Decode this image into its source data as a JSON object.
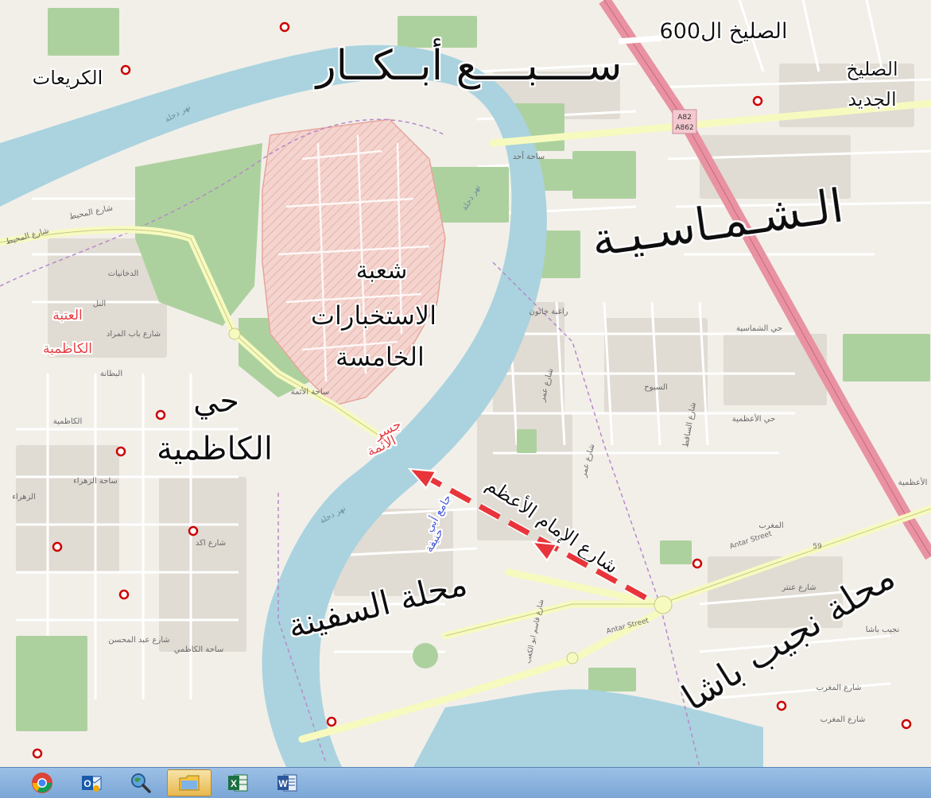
{
  "map": {
    "labels": {
      "sulaikh600": "الصليخ ال600",
      "sabaa_abkar": "ســــبــــع أبــكــار",
      "sulaikh_jadid_1": "الصليخ",
      "sulaikh_jadid_2": "الجديد",
      "kuraiat": "الكريعات",
      "shamasiya": "الـشـمـاسـيـة",
      "shuaba_1": "شعبة",
      "shuaba_2": "الاستخبارات",
      "shuaba_3": "الخامسة",
      "ataba_1": "العتبة",
      "ataba_2": "الكاظمية",
      "hay_1": "حي",
      "hay_2": "الكاظمية",
      "jisr_1": "جسر",
      "jisr_2": "الأئمة",
      "jami_1": "جامع أبي",
      "jami_2": "حنيفة",
      "imam_street": "شارع الإمام الأعظم",
      "safina": "محلة السفينة",
      "najib": "محلة نجيب باشا"
    },
    "small_labels": {
      "a82": "A82",
      "a862": "A862",
      "sahat_ahad": "ساحة أحد",
      "nahr_dijla": "نهر دجلة",
      "raghiba": "راغبة خاتون",
      "hay_shamasiya": "حي الشماسية",
      "suwaij": "السبوح",
      "hay_adhamiya": "حي الأعظمية",
      "adhamiya": "الأعظمية",
      "maghrib": "المغرب",
      "antar1": "Antar Street",
      "antar2": "Antar Street",
      "najib_small": "نجيب باشا",
      "sh_maghrib1": "شارع المغرب",
      "sh_maghrib2": "شارع المغرب",
      "sh_muhit": "شارع المحيط",
      "sh_muhit2": "شارع المحيط",
      "dakhaniyat": "الدخانيات",
      "bab_murad": "شارع باب المراد",
      "tall": "التل",
      "battana": "البطانة",
      "kadhimiya": "الكاظمية",
      "sahat_aimma": "ساحة الأئمة",
      "sahat_zahraa": "ساحة الزهراء",
      "zahraa": "الزهراء",
      "sahat_kadhimi": "ساحة الكاظمي",
      "sh_abd_muhsin": "شارع عبد المحسن",
      "sh_akd": "شارع اكد",
      "sh_omar": "شارع عمر",
      "sh_saqqat": "شارع الساقط",
      "sh_qasim": "شارع قاسم ابو الكعب",
      "sh_antar_small": "شارع عنتر",
      "num": "59"
    }
  },
  "taskbar": {
    "apps": [
      {
        "name": "chrome"
      },
      {
        "name": "outlook"
      },
      {
        "name": "search-tool"
      },
      {
        "name": "file-explorer"
      },
      {
        "name": "excel"
      },
      {
        "name": "word"
      }
    ],
    "outlook_letter": "O",
    "excel_letter": "X",
    "word_letter": "W"
  },
  "colors": {
    "river": "#aad3df",
    "park": "#add19e",
    "military": "#f2c7c0",
    "trunk": "#e892a2",
    "primary": "#f7fabf",
    "arrow": "#e8343a"
  }
}
